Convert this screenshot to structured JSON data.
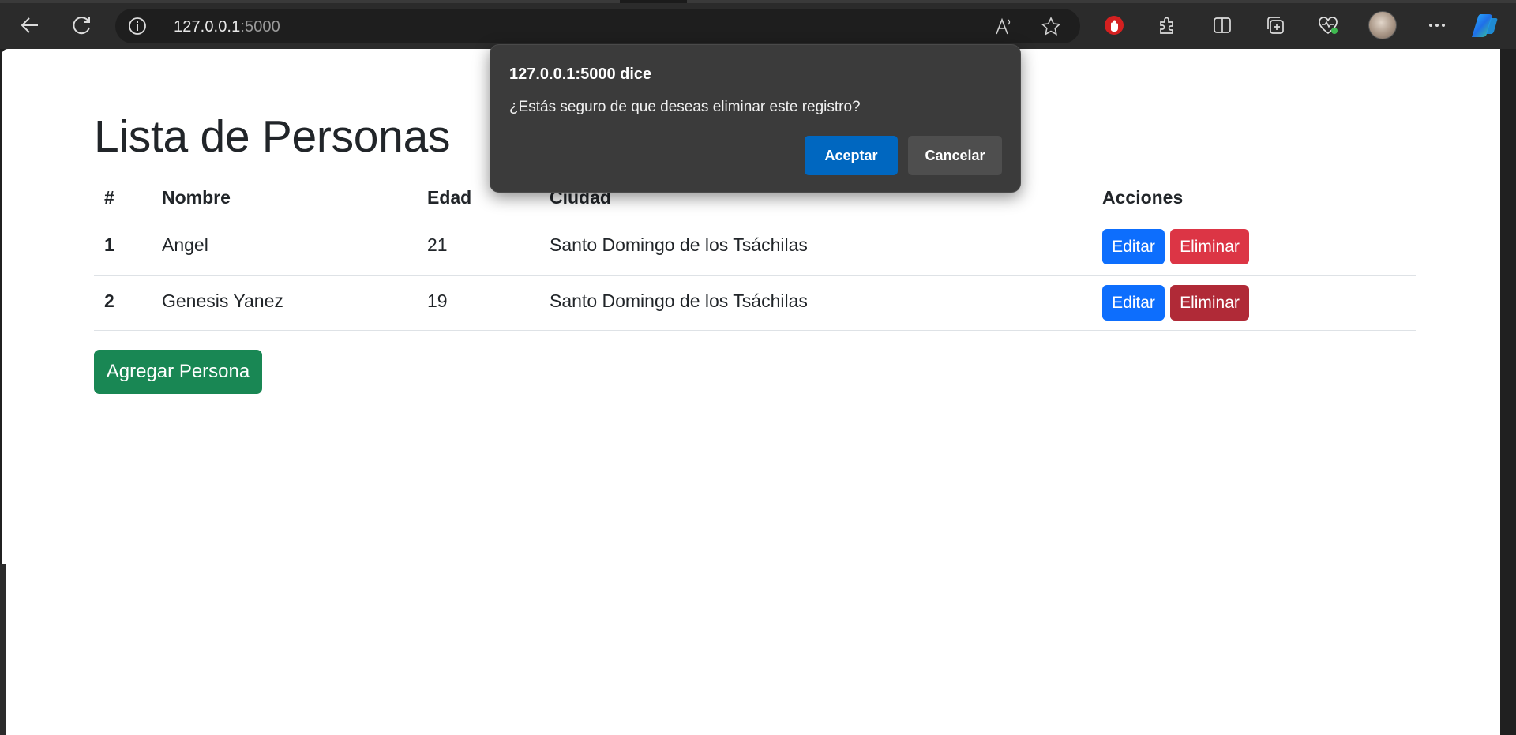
{
  "browser": {
    "url_host": "127.0.0.1",
    "url_port": ":5000",
    "icons": [
      "back-icon",
      "refresh-icon",
      "site-info-icon",
      "read-aloud-icon",
      "favorite-star-icon",
      "extension-stop-icon",
      "extensions-icon",
      "split-screen-icon",
      "collections-icon",
      "browser-essentials-icon",
      "profile-avatar",
      "more-menu-icon",
      "copilot-icon"
    ]
  },
  "page": {
    "title": "Lista de Personas",
    "table": {
      "headers": [
        "#",
        "Nombre",
        "Edad",
        "Ciudad",
        "Acciones"
      ],
      "rows": [
        {
          "id": "1",
          "nombre": "Angel",
          "edad": "21",
          "ciudad": "Santo Domingo de los Tsáchilas",
          "edit_label": "Editar",
          "delete_label": "Eliminar"
        },
        {
          "id": "2",
          "nombre": "Genesis Yanez",
          "edad": "19",
          "ciudad": "Santo Domingo de los Tsáchilas",
          "edit_label": "Editar",
          "delete_label": "Eliminar"
        }
      ]
    },
    "add_button": "Agregar Persona"
  },
  "dialog": {
    "title": "127.0.0.1:5000 dice",
    "message": "¿Estás seguro de que deseas eliminar este registro?",
    "ok_label": "Aceptar",
    "cancel_label": "Cancelar"
  },
  "colors": {
    "primary": "#0d6efd",
    "danger": "#dc3545",
    "danger_active": "#b02a37",
    "success": "#198754",
    "dialog_bg": "#3b3b3b",
    "dialog_ok": "#0067c0"
  }
}
